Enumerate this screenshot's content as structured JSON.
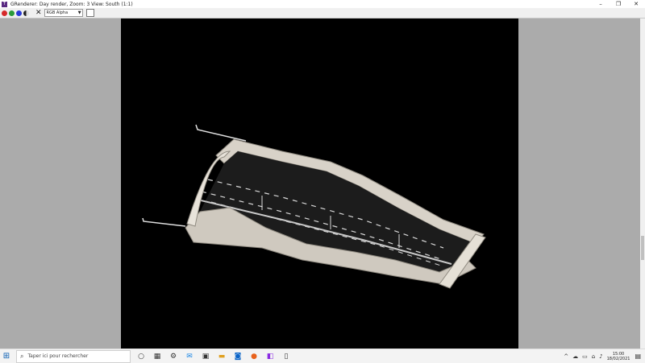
{
  "window": {
    "title": "GRenderer: Day render, Zoom: 3 View: South (1:1)",
    "app_icon": "app-logo-icon",
    "controls": [
      "minimize-icon",
      "restore-icon",
      "close-icon"
    ],
    "minimize": "–",
    "restore": "❐",
    "close": "✕"
  },
  "toolbar": {
    "color_buttons": [
      "red-channel",
      "green-channel",
      "blue-channel",
      "alpha-channel"
    ],
    "reset_glyph": "✕",
    "channel_select_value": "RGB Alpha",
    "swatch_color": "#ffffff"
  },
  "viewport": {
    "background": "#000000",
    "surround": "#ababab"
  },
  "taskbar": {
    "start_glyph": "⊞",
    "search_placeholder": "Taper ici pour rechercher",
    "pinned_icons": [
      "task-view-icon",
      "widgets-icon",
      "settings-icon",
      "mail-icon",
      "photos-icon",
      "file-explorer-icon",
      "outlook-icon",
      "firefox-icon",
      "visual-studio-icon",
      "notepad-icon"
    ],
    "time": "15:00",
    "date": "18/02/2021"
  }
}
